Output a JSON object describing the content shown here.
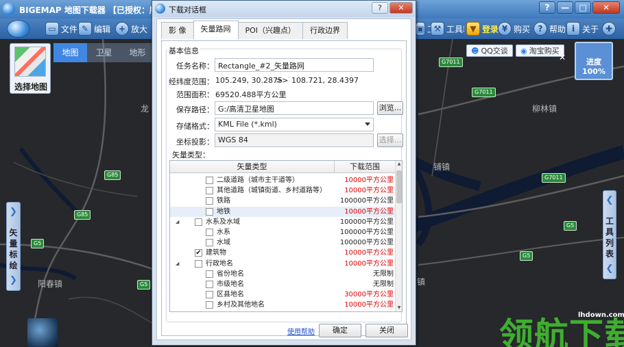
{
  "app": {
    "title": "BIGEMAP 地图下载器 【已授权：所有地",
    "window_buttons": [
      "?",
      "—",
      "□",
      "✕"
    ]
  },
  "toolbar": {
    "items": [
      {
        "label": "文件",
        "icon": "folder-icon"
      },
      {
        "label": "编辑",
        "icon": "edit-icon"
      },
      {
        "label": "放大",
        "icon": "zoom-in-icon"
      },
      {
        "label": "工具箱",
        "icon": "toolbox-icon"
      },
      {
        "label": "登录",
        "icon": "login-icon"
      },
      {
        "label": "购买",
        "icon": "cart-icon"
      },
      {
        "label": "帮助",
        "icon": "help-icon"
      },
      {
        "label": "关于",
        "icon": "about-icon"
      }
    ],
    "login_color": "#ffeb3b"
  },
  "map": {
    "choose_map_label": "选择地图",
    "tabs": [
      "地图",
      "卫星",
      "地形"
    ],
    "active_tab": "地图",
    "qq_button": "QQ交谈",
    "buy_button": "淘宝购买",
    "progress_label": "进度100%",
    "left_panel": [
      "矢",
      "量",
      "标",
      "绘"
    ],
    "right_panel": [
      "工",
      "具",
      "列",
      "表"
    ],
    "place_labels": [
      "龙",
      "柳林镇",
      "铺镇",
      "阳春镇",
      "乡镇",
      "镇"
    ],
    "road_badges": [
      "G7011",
      "G7011",
      "G7011",
      "G85",
      "G85",
      "G5",
      "G5",
      "G5",
      "G5"
    ],
    "watermark": "领航下载",
    "watermark_url": "lhdown.com"
  },
  "dialog": {
    "title": "下载对话框",
    "help_btn": "?",
    "close_btn": "✕",
    "tabs": [
      "影 像",
      "矢量路网",
      "POI（兴趣点）",
      "行政边界"
    ],
    "active_tab": "矢量路网",
    "group_title": "基本信息",
    "task_name_label": "任务名称：",
    "task_name_value": "Rectangle_#2_矢量路网",
    "range_label": "经纬度范围：",
    "range_from": "105.249, 30.2875",
    "range_arrow": ">>",
    "range_to": "108.721, 28.4397",
    "area_label": "范围面积：",
    "area_value": "69520.488平方公里",
    "save_path_label": "保存路径：",
    "save_path_value": "G:/高清卫星地图",
    "browse_btn": "浏览...",
    "format_label": "存储格式：",
    "format_value": "KML File (*.kml)",
    "projection_label": "坐标投影：",
    "projection_value": "WGS 84",
    "select_btn": "选择...",
    "vector_type_label": "矢量类型：",
    "tree_headers": [
      "矢量类型",
      "下载范围"
    ],
    "tree_rows": [
      {
        "name": "二级道路（城市主干道等）",
        "range": "10000平方公里",
        "red": true,
        "level": 2,
        "checked": false,
        "expander": ""
      },
      {
        "name": "其他道路（城镇街道、乡村道路等）",
        "range": "10000平方公里",
        "red": true,
        "level": 2,
        "checked": false,
        "expander": ""
      },
      {
        "name": "铁路",
        "range": "100000平方公里",
        "red": false,
        "level": 2,
        "checked": false,
        "expander": ""
      },
      {
        "name": "地铁",
        "range": "10000平方公里",
        "red": true,
        "level": 2,
        "checked": false,
        "expander": "",
        "selected": true
      },
      {
        "name": "水系及水域",
        "range": "100000平方公里",
        "red": false,
        "level": 1,
        "checked": false,
        "expander": "◢"
      },
      {
        "name": "水系",
        "range": "100000平方公里",
        "red": false,
        "level": 2,
        "checked": false,
        "expander": ""
      },
      {
        "name": "水域",
        "range": "100000平方公里",
        "red": false,
        "level": 2,
        "checked": false,
        "expander": ""
      },
      {
        "name": "建筑物",
        "range": "10000平方公里",
        "red": true,
        "level": 1,
        "checked": true,
        "expander": ""
      },
      {
        "name": "行政地名",
        "range": "10000平方公里",
        "red": true,
        "level": 1,
        "checked": false,
        "expander": "◢"
      },
      {
        "name": "省份地名",
        "range": "无限制",
        "red": false,
        "level": 2,
        "checked": false,
        "expander": ""
      },
      {
        "name": "市级地名",
        "range": "无限制",
        "red": false,
        "level": 2,
        "checked": false,
        "expander": ""
      },
      {
        "name": "区县地名",
        "range": "30000平方公里",
        "red": true,
        "level": 2,
        "checked": false,
        "expander": ""
      },
      {
        "name": "乡村及其他地名",
        "range": "10000平方公里",
        "red": true,
        "level": 2,
        "checked": false,
        "expander": ""
      }
    ],
    "help_link": "使用帮助",
    "ok_btn": "确定",
    "close_action_btn": "关闭"
  }
}
